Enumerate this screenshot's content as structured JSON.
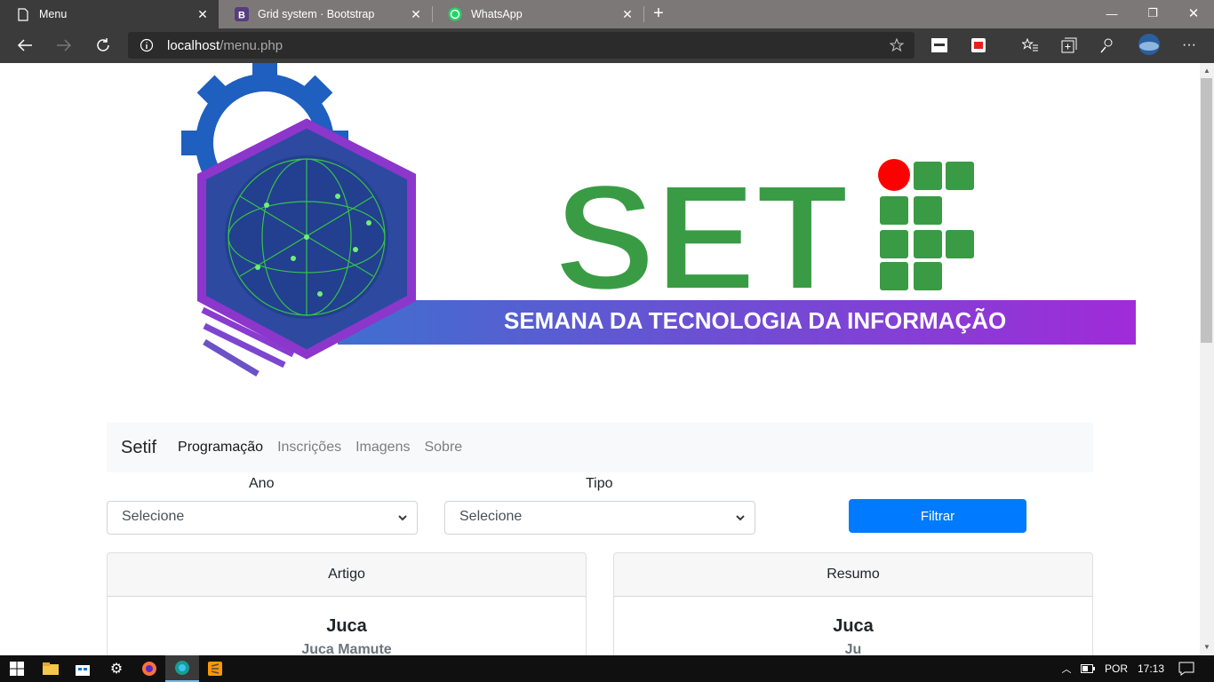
{
  "browser": {
    "tabs": [
      {
        "title": "Menu",
        "icon": "page-icon",
        "active": true
      },
      {
        "title": "Grid system · Bootstrap",
        "icon": "bootstrap-icon",
        "active": false
      },
      {
        "title": "WhatsApp",
        "icon": "whatsapp-icon",
        "active": false
      }
    ],
    "url_host": "localhost",
    "url_path": "/menu.php"
  },
  "banner": {
    "logo_text": "SETIF",
    "tagline": "SEMANA DA TECNOLOGIA DA INFORMAÇÃO",
    "colors": {
      "green": "#3a9b45",
      "purple": "#9b2bd6",
      "blue": "#2c4a9a",
      "red": "#ff0000"
    }
  },
  "site_nav": {
    "brand": "Setif",
    "links": [
      {
        "label": "Programação",
        "active": true
      },
      {
        "label": "Inscrições",
        "active": false
      },
      {
        "label": "Imagens",
        "active": false
      },
      {
        "label": "Sobre",
        "active": false
      }
    ]
  },
  "filters": {
    "ano_label": "Ano",
    "ano_value": "Selecione",
    "tipo_label": "Tipo",
    "tipo_value": "Selecione",
    "button": "Filtrar"
  },
  "cards": [
    {
      "header": "Artigo",
      "title": "Juca",
      "subtitle": "Juca Mamute"
    },
    {
      "header": "Resumo",
      "title": "Juca",
      "subtitle": "Ju"
    }
  ],
  "taskbar": {
    "language": "POR",
    "time": "17:13"
  },
  "accent": "#007bff"
}
